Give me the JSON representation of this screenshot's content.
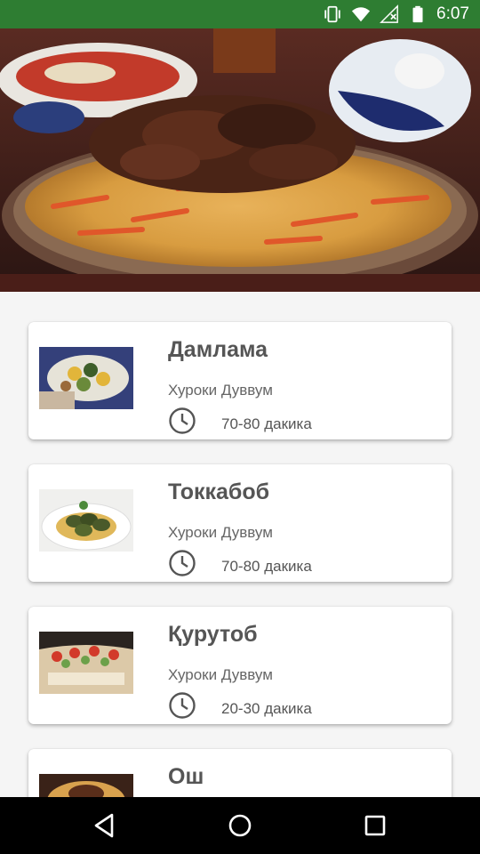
{
  "status_bar": {
    "time": "6:07",
    "icons": [
      "vibrate-icon",
      "wifi-icon",
      "no-signal-icon",
      "battery-icon"
    ]
  },
  "hero": {
    "image": "plov-dish-photo"
  },
  "recipes": [
    {
      "title": "Дамлама",
      "category": "Хуроки Дуввум",
      "duration": "70-80 дакика",
      "image": "damlama-photo"
    },
    {
      "title": "Токкабоб",
      "category": "Хуроки Дуввум",
      "duration": "70-80 дакика",
      "image": "tokkabob-photo"
    },
    {
      "title": "Қурутоб",
      "category": "Хуроки Дуввум",
      "duration": "20-30 дакика",
      "image": "qurutob-photo"
    },
    {
      "title": "Ош",
      "category": "",
      "duration": "",
      "image": "osh-photo"
    }
  ],
  "nav_bar": {
    "icons": [
      "back-icon",
      "home-icon",
      "recents-icon"
    ]
  },
  "colors": {
    "status_bar": "#2e7d32",
    "background": "#f5f5f5",
    "card": "#ffffff",
    "title_text": "#555555"
  }
}
